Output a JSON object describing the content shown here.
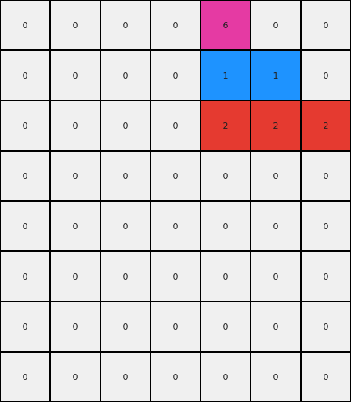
{
  "grid": {
    "rows": [
      [
        0,
        0,
        0,
        0,
        6,
        0,
        0
      ],
      [
        0,
        0,
        0,
        0,
        1,
        1,
        0
      ],
      [
        0,
        0,
        0,
        0,
        2,
        2,
        2
      ],
      [
        0,
        0,
        0,
        0,
        0,
        0,
        0
      ],
      [
        0,
        0,
        0,
        0,
        0,
        0,
        0
      ],
      [
        0,
        0,
        0,
        0,
        0,
        0,
        0
      ],
      [
        0,
        0,
        0,
        0,
        0,
        0,
        0
      ],
      [
        0,
        0,
        0,
        0,
        0,
        0,
        0
      ]
    ],
    "palette": {
      "0": "#f0f0f0",
      "1": "#1e93ff",
      "2": "#e53a30",
      "6": "#e53aa3"
    },
    "grid_line_color": "#000000"
  }
}
